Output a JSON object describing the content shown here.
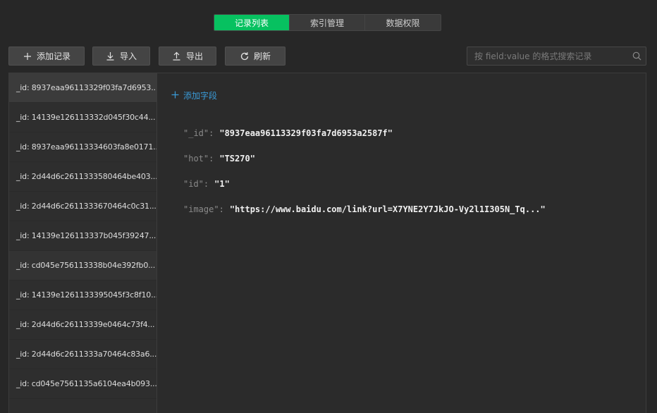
{
  "tabs": [
    {
      "label": "记录列表",
      "active": true
    },
    {
      "label": "索引管理",
      "active": false
    },
    {
      "label": "数据权限",
      "active": false
    }
  ],
  "toolbar": {
    "add_label": "添加记录",
    "import_label": "导入",
    "export_label": "导出",
    "refresh_label": "刷新"
  },
  "search": {
    "placeholder": "按 field:value 的格式搜索记录",
    "value": ""
  },
  "records": [
    "_id: 8937eaa96113329f03fa7d6953...",
    "_id: 14139e126113332d045f30c44...",
    "_id: 8937eaa96113334603fa8e0171...",
    "_id: 2d44d6c2611333580464be403...",
    "_id: 2d44d6c2611333670464c0c31...",
    "_id: 14139e126113337b045f39247...",
    "_id: cd045e756113338b04e392fb0...",
    "_id: 14139e1261133395045f3c8f10...",
    "_id: 2d44d6c26113339e0464c73f4...",
    "_id: 2d44d6c2611333a70464c83a6...",
    "_id: cd045e7561135a6104ea4b093..."
  ],
  "detail": {
    "add_field_label": "添加字段",
    "fields": [
      {
        "key": "\"_id\"",
        "value": "\"8937eaa96113329f03fa7d6953a2587f\""
      },
      {
        "key": "\"hot\"",
        "value": "\"TS270\""
      },
      {
        "key": "\"id\"",
        "value": "\"1\""
      },
      {
        "key": "\"image\"",
        "value": "\"https://www.baidu.com/link?url=X7YNE2Y7JkJO-Vy2l1I305N_Tq...\""
      }
    ]
  },
  "colors": {
    "accent": "#07c160",
    "link": "#3a9bd8",
    "background": "#272727"
  }
}
